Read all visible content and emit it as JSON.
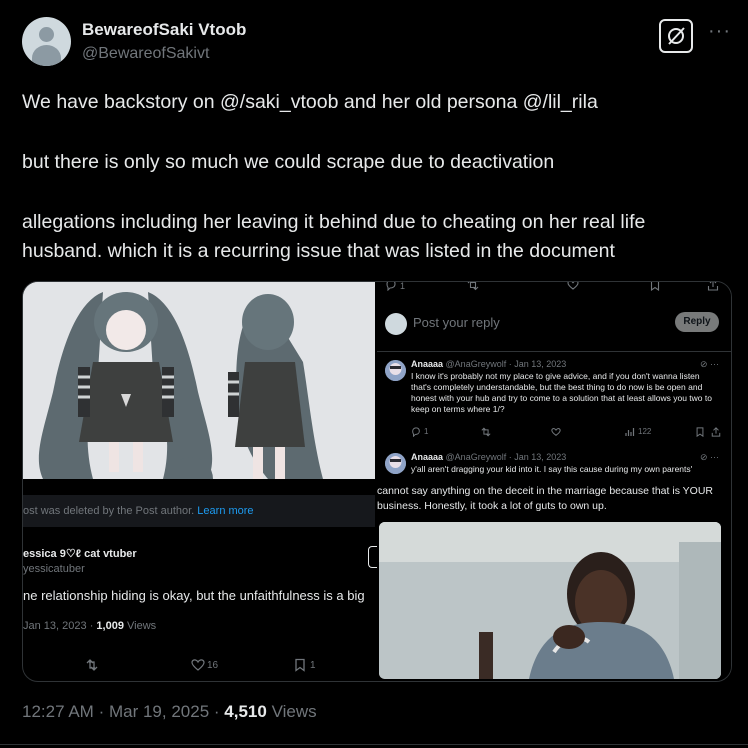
{
  "tweet": {
    "display_name": "BewareofSaki Vtoob",
    "handle": "@BewareofSakivt",
    "paragraphs": [
      "We have backstory on @/saki_vtoob and her old persona @/lil_rila",
      "but there is only so much we could scrape due to deactivation",
      "allegations including her leaving it behind due to cheating on her real life",
      "husband. which it is a recurring issue that was listed in the document"
    ],
    "time": "12:27 AM",
    "date": "Mar 19, 2025",
    "views_count": "4,510",
    "views_label": "Views",
    "sep": "·"
  },
  "left_panel": {
    "deleted_text": "ost was deleted by the Post author.",
    "learn_more": "Learn more",
    "quote_name": "essica 9♡ℓ cat vtuber",
    "quote_handle": "yessicatuber",
    "quote_text": "ne relationship hiding is okay, but the unfaithfulness is a big",
    "quote_date": "Jan 13, 2023",
    "quote_views_count": "1,009",
    "quote_views_label": "Views",
    "likes": "16",
    "bookmarks": "1"
  },
  "right_panel": {
    "top_reply_count": "1",
    "reply_placeholder": "Post your reply",
    "reply_button": "Reply",
    "comment1": {
      "name": "Anaaaa",
      "handle_date": "@AnaGreywolf · Jan 13, 2023",
      "text": "I know it's probably not my place to give advice, and if you don't wanna listen that's completely understandable, but the best thing to do now is be open and honest with your hub and try to come to a solution that at least allows you two to keep on terms where 1/?",
      "replies": "1",
      "views": "122"
    },
    "comment2": {
      "name": "Anaaaa",
      "handle_date": "@AnaGreywolf · Jan 13, 2023",
      "text": "y'all aren't dragging your kid into it. I say this cause during my own parents'"
    },
    "overlay_text": "cannot say anything on the deceit in the marriage because that is YOUR business. Honestly, it took a lot of guts to own up."
  },
  "colors": {
    "background": "#000000",
    "text": "#e7e9ea",
    "muted": "#71767b",
    "link": "#1d9bf0"
  }
}
